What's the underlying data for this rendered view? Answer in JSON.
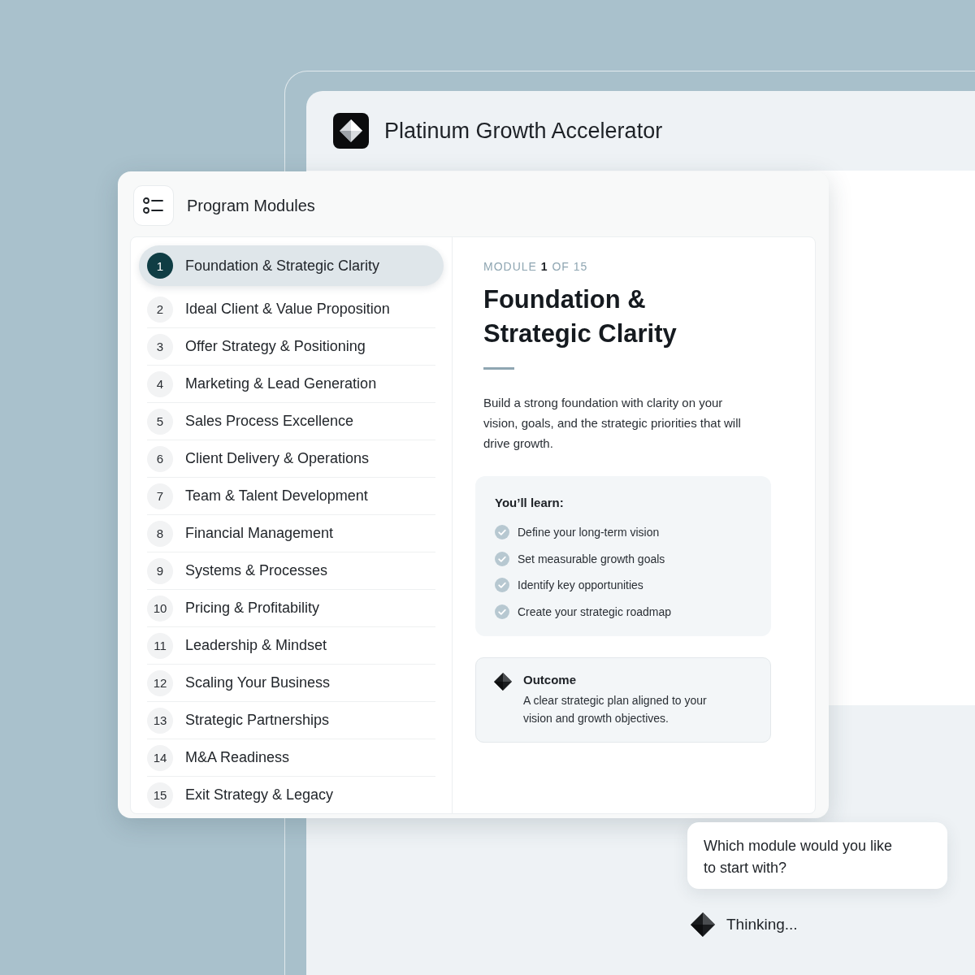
{
  "app": {
    "title": "Platinum Growth Accelerator"
  },
  "panel": {
    "title": "Program Modules"
  },
  "modules": [
    {
      "number": "1",
      "title": "Foundation & Strategic Clarity",
      "selected": true
    },
    {
      "number": "2",
      "title": "Ideal Client & Value Proposition",
      "selected": false
    },
    {
      "number": "3",
      "title": "Offer Strategy & Positioning",
      "selected": false
    },
    {
      "number": "4",
      "title": "Marketing & Lead Generation",
      "selected": false
    },
    {
      "number": "5",
      "title": "Sales Process Excellence",
      "selected": false
    },
    {
      "number": "6",
      "title": "Client Delivery & Operations",
      "selected": false
    },
    {
      "number": "7",
      "title": "Team & Talent Development",
      "selected": false
    },
    {
      "number": "8",
      "title": "Financial Management",
      "selected": false
    },
    {
      "number": "9",
      "title": "Systems & Processes",
      "selected": false
    },
    {
      "number": "10",
      "title": "Pricing & Profitability",
      "selected": false
    },
    {
      "number": "11",
      "title": "Leadership & Mindset",
      "selected": false
    },
    {
      "number": "12",
      "title": "Scaling Your Business",
      "selected": false
    },
    {
      "number": "13",
      "title": "Strategic Partnerships",
      "selected": false
    },
    {
      "number": "14",
      "title": "M&A Readiness",
      "selected": false
    },
    {
      "number": "15",
      "title": "Exit Strategy & Legacy",
      "selected": false
    }
  ],
  "detail": {
    "eyebrow": "MODULE **1** OF 15",
    "title": "Foundation & Strategic Clarity",
    "description": "Build a strong foundation with clarity on your vision, goals, and the strategic priorities that will drive growth.",
    "learn": {
      "heading": "You’ll learn:",
      "items": [
        "Define your long-term vision",
        "Set measurable growth goals",
        "Identify key opportunities",
        "Create your strategic roadmap"
      ]
    },
    "outcome": {
      "heading": "Outcome",
      "text": "A clear strategic plan aligned to your vision and growth objectives."
    }
  },
  "chat": {
    "message": "Which module would you like to start with?",
    "status": "Thinking..."
  }
}
